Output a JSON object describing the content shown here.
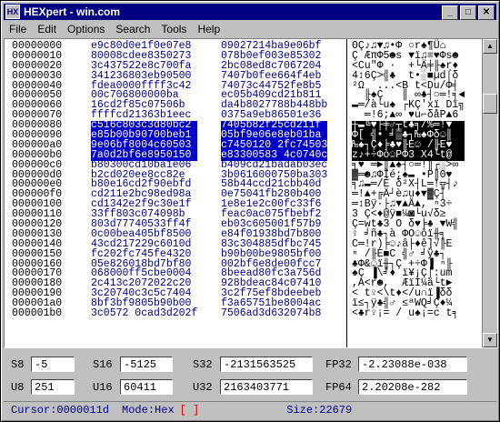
{
  "window": {
    "title": "HEXpert - win.com",
    "minimize": "_",
    "maximize": "□",
    "close": "✕"
  },
  "menu": [
    "File",
    "Edit",
    "Options",
    "Search",
    "Tools",
    "Help"
  ],
  "addresses": [
    "00000000",
    "00000010",
    "00000020",
    "00000030",
    "00000040",
    "00000050",
    "00000060",
    "00000070",
    "00000080",
    "00000090",
    "000000a0",
    "000000b0",
    "000000c0",
    "000000d0",
    "000000e0",
    "000000f0",
    "00000100",
    "00000110",
    "00000120",
    "00000130",
    "00000140",
    "00000150",
    "00000160",
    "00000170",
    "00000180",
    "00000190",
    "000001a0",
    "000001b0"
  ],
  "hex_left": [
    "e9c80d0e1f0e07e8",
    "80008cdee8350273",
    "3c437522e8c700fa",
    "341236803eb90500",
    "fdea0000ffff3c42",
    "00c706800000ba",
    "16cd2f85c07506b",
    "ffffcd21363b1eec",
    "c516c803c3d80bc2",
    "e85b00b90700beb1",
    "9e06bf8004c60503",
    "7a0d2bf6e8950150",
    "b80300cd10ba1e06",
    "b2cd020ee8cc82e",
    "b80e16cd2f90ebfd",
    "cd211e2bc98ed98a",
    "cd1342e2f9c30e1f",
    "33ff803c074098b",
    "803d77740533ff4f",
    "0c00bea405bf8500",
    "43cd217229c6010d",
    "fc202fc745fe4320",
    "05e826018bd7bf80",
    "068000ff5cbe0004",
    "2c413c2072022c20",
    "3c20740c3c5c7404",
    "8bf3bf9805b90b00",
    "3c0572 0cad3d202f"
  ],
  "hex_right": [
    "09027214ba9e06bf",
    "078b0ef003e85302",
    "2bc08ed8c7067204",
    "7407b0fee664f4eb",
    "74073c44752fe8b5",
    "ec05b409cd21b811",
    "da4b8027788b448bb",
    "0375a9eb86501e36",
    "7405b82f25cd211f",
    "05bf9e06e8eb01ba",
    "c7450120 2fc74503",
    "e83300583 4c0740c",
    "b409cd21badab03ec",
    "3b0616000750ba303",
    "58b44ccd21cbb40d",
    "0e75041fb280b400",
    "1e8e1e2c00fc33f6",
    "feac0ac075fbebf2",
    "eb03c605001f57b9",
    "e84f01938bd7b800",
    "83c304885dfbc745",
    "b90b00be9805bf00",
    "002bf6e8de00fcc7",
    "8beead80fc3a756d",
    "928bdeac84c07410",
    "3c2f75ef8bdeebeb",
    "f3a65751be8004ac",
    "7506ad3d632074b8"
  ],
  "ascii": [
    "ΘÇ♪♫▼♫•Φ ○r♠¶Ü⌂",
    "Ç ÆπΦ5☻s ▼ï♫≡♥Φs☻",
    "<Cu\"Φ ·  +└Ä╪╟♠r♦",
    "4↕6Ç>╣♣  t•░■µd⌠δ",
    "²Ω  ...<B t<Du/Φ╡",
    "  ╟♠Ç   ║ ∞♣┤○═!╕◄",
    "▬═/à└u♠ ┌KÇ'xï Dï╗",
    "  ═!6;▲∞ ♥u⌐δåP▲6",
    "┼▬╚♥├╪♂┬t♣╕/%═!▼",
    "Φ[ ╣• ╛▒♣┐₧♠Φδ☺║",
    "₧♠┐Ç♦╞♣♥╟E☺ /╟E♥",
    "z♪+÷Φò☺PΦ3 X4└t@",
    "╕♥ ═►║▲♠┤○═!║┌░>∞",
    "▓═☻♫ΦÌé;♠▬ •P║0♥",
    "╕♫▬═/É δ²X┤L═!╦┤♪",
    "═!▲+╔Ä┘è♫u♦▼▓Ç┤",
    "═↕Bÿ∙├♫▼▲Ä▲, ⁿ3÷",
    "3 Ç<♦@ÿ■¼◙└u√δ≥",
    "Ç=wt♣3 O δ♥╞♣ ▼W╣",
    "♀ ╛ñ♣┐à ΦO☺ôï╫╕",
    "C═!r)╞☺♪â├♦ê]√╟E",
    "ⁿ /╟E■C ╣♂ ╛ÿ♣┐",
    "♣Φ&☺ï╫┐Ç +÷Φ▐ ⁿ╟",
    "♠Ç ▐\\╛♦ ï¥¡Ç⌡:um",
    ",A<r☻,  ÆïÌ¼ä└t►",
    "< t♀<\\t♦</u∩ï▐δδ",
    "ï≤┐ÿ♣╣♂ ≤ªWQ╛Ç♦¼",
    "<♣r♀¡= / u♠¡=c t╕"
  ],
  "fields": {
    "s8_label": "S8",
    "s8": "-5",
    "s16_label": "S16",
    "s16": "-5125",
    "s32_label": "S32",
    "s32": "-2131563525",
    "fp32_label": "FP32",
    "fp32": "-2.23088e-038",
    "u8_label": "U8",
    "u8": "251",
    "u16_label": "U16",
    "u16": "60411",
    "u32_label": "U32",
    "u32": "2163403771",
    "fp64_label": "FP64",
    "fp64": "2.20208e-282"
  },
  "status": {
    "cursor": "Cursor:0000011d",
    "mode": "Mode:Hex",
    "bracket": "[  ]",
    "size": "Size:22679"
  },
  "colors": {
    "titlebar": "#000080",
    "hex_text": "#00008b",
    "selection": "#0000c8",
    "cursor": "#e00000"
  }
}
